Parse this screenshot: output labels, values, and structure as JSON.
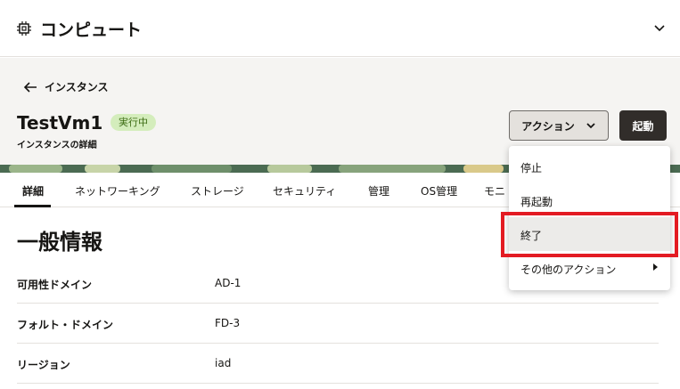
{
  "header": {
    "title": "コンピュート",
    "icon": "chip-icon",
    "collapse_icon": "chevron-down-icon"
  },
  "breadcrumb": {
    "back_label": "インスタンス"
  },
  "instance": {
    "name": "TestVm1",
    "status": "実行中",
    "subtitle": "インスタンスの詳細"
  },
  "toolbar": {
    "actions_label": "アクション",
    "start_label": "起動"
  },
  "tabs": [
    {
      "label": "詳細",
      "active": true
    },
    {
      "label": "ネットワーキング"
    },
    {
      "label": "ストレージ"
    },
    {
      "label": "セキュリティ"
    },
    {
      "label": "管理"
    },
    {
      "label": "OS管理"
    },
    {
      "label": "モニ"
    }
  ],
  "section": {
    "title": "一般情報"
  },
  "details": [
    {
      "key": "可用性ドメイン",
      "value": "AD-1"
    },
    {
      "key": "フォルト・ドメイン",
      "value": "FD-3"
    },
    {
      "key": "リージョン",
      "value": "iad"
    }
  ],
  "menu": {
    "items": [
      {
        "label": "停止"
      },
      {
        "label": "再起動"
      },
      {
        "label": "終了",
        "selected": true
      },
      {
        "label": "その他のアクション",
        "submenu": true
      }
    ]
  },
  "colors": {
    "highlight": "#e31b23",
    "status_bg": "#d4edbc",
    "primary_button": "#312d2a"
  }
}
